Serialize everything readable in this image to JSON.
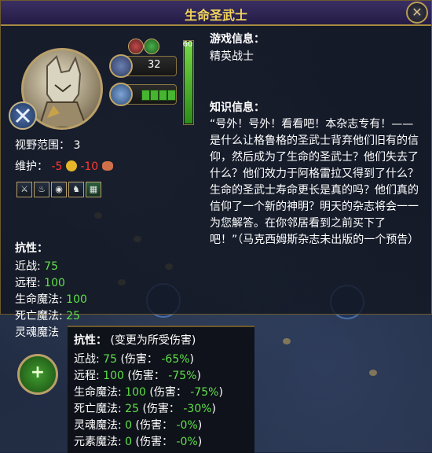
{
  "window": {
    "title": "生命圣武士",
    "close_icon": "close-icon"
  },
  "unit": {
    "attack": "32",
    "level": "60",
    "level_fraction": 1.0,
    "defense_pips": 4,
    "view_range_label": "视野范围：",
    "view_range_value": "3",
    "upkeep_label": "维护：",
    "upkeep_gold": "-5",
    "upkeep_food": "-10"
  },
  "info": {
    "game_heading": "游戏信息：",
    "game_value": "精英战士",
    "lore_heading": "知识信息：",
    "lore_text": "“号外！号外！看看吧！本杂志专有！——是什么让格鲁格的圣武士背弃他们旧有的信仰，然后成为了生命的圣武士？他们失去了什么？他们效力于阿格雷拉又得到了什么？生命的圣武士寿命更长是真的吗？他们真的信仰了一个新的神明？明天的杂志将会一一为您解答。在你邻居看到之前买下了吧！”（马克西姆斯杂志未出版的一个预告）"
  },
  "resist": {
    "heading": "抗性：",
    "rows": [
      {
        "name": "近战:",
        "value": "75"
      },
      {
        "name": "远程:",
        "value": "100"
      },
      {
        "name": "生命魔法:",
        "value": "100"
      },
      {
        "name": "死亡魔法:",
        "value": "25"
      },
      {
        "name": "灵魂魔法",
        "value": ""
      }
    ]
  },
  "tooltip": {
    "heading": "抗性：",
    "subheading": "(变更为所受伤害)",
    "rows": [
      {
        "name": "近战:",
        "value": "75",
        "damage_label": "(伤害：",
        "damage": "-65%",
        "close": ")"
      },
      {
        "name": "远程:",
        "value": "100",
        "damage_label": "(伤害：",
        "damage": "-75%",
        "close": ")"
      },
      {
        "name": "生命魔法:",
        "value": "100",
        "damage_label": "(伤害：",
        "damage": "-75%",
        "close": ")"
      },
      {
        "name": "死亡魔法:",
        "value": "25",
        "damage_label": "(伤害：",
        "damage": "-30%",
        "close": ")"
      },
      {
        "name": "灵魂魔法:",
        "value": "0",
        "damage_label": "(伤害：",
        "damage": "-0%",
        "close": ")"
      },
      {
        "name": "元素魔法:",
        "value": "0",
        "damage_label": "(伤害：",
        "damage": "-0%",
        "close": ")"
      }
    ]
  },
  "colors": {
    "accent": "#f2d45c",
    "positive": "#5fe04a",
    "negative": "#ff3a30",
    "border": "#a48a43"
  }
}
